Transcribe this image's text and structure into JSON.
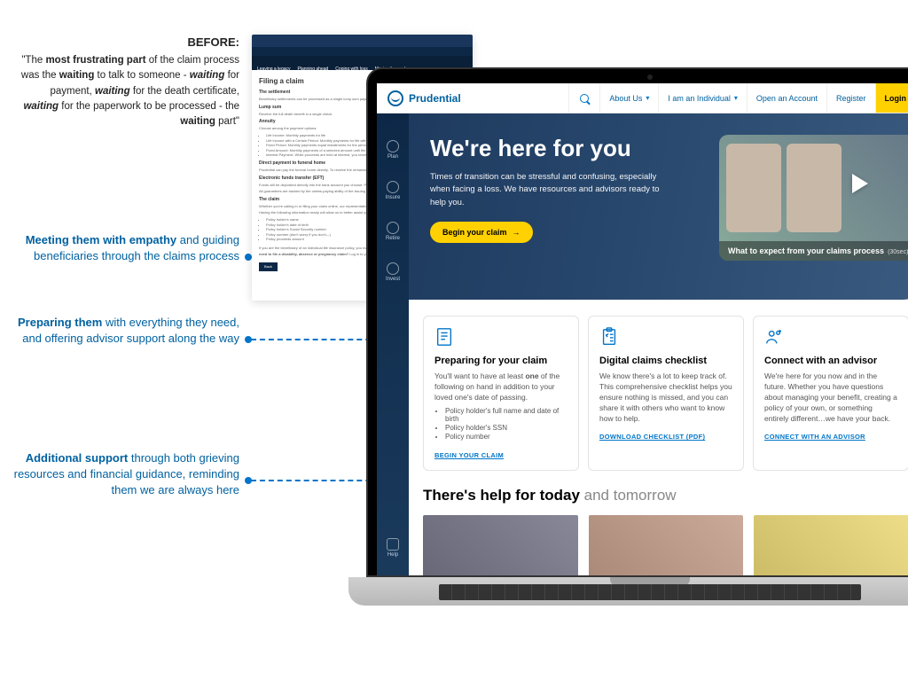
{
  "annotations": {
    "before_label": "BEFORE:",
    "quote_html": "\"The <b>most frustrating part</b> of the claim process was the <b>waiting</b> to talk to someone - <b><i>waiting</i></b> for payment, <b><i>waiting</i></b> for the death certificate, <b><i>waiting</i></b> for the paperwork to be processed - the <b>waiting</b> part\"",
    "callout1_html": "<b>Meeting them with empathy</b> and guiding beneficiaries through the claims process",
    "callout2_html": "<b>Preparing them</b> with everything they need, and offering advisor support along the way",
    "callout3_html": "<b>Additional support</b> through both grieving resources and financial guidance, reminding them we are always here"
  },
  "before": {
    "title": "Filing a claim",
    "nav": [
      "Leaving a legacy",
      "Planning ahead",
      "Coping with loss",
      "Moving forward"
    ],
    "sections": [
      "The settlement",
      "Lump sum",
      "Annuity",
      "Direct payment to funeral home",
      "Electronic funds transfer (EFT)",
      "The claim"
    ],
    "button": "Back"
  },
  "topnav": {
    "brand": "Prudential",
    "about": "About Us",
    "persona": "I am an Individual",
    "open": "Open an Account",
    "register": "Register",
    "login": "Login"
  },
  "sidebar": [
    "Plan",
    "Insure",
    "Retire",
    "Invest",
    "Help"
  ],
  "hero": {
    "title": "We're here for you",
    "body": "Times of transition can be stressful and confusing, especially when facing a loss. We have resources and advisors ready to help you.",
    "cta": "Begin your claim",
    "video_caption": "What to expect from your claims process",
    "video_time": "(30sec)"
  },
  "cards": [
    {
      "title": "Preparing for your claim",
      "body_html": "You'll want to have at least <b>one</b> of the following on hand in addition to your loved one's date of passing.",
      "bullets": [
        "Policy holder's full name and date of birth",
        "Policy holder's SSN",
        "Policy number"
      ],
      "link": "BEGIN YOUR CLAIM"
    },
    {
      "title": "Digital claims checklist",
      "body": "We know there's a lot to keep track of. This comprehensive checklist helps you ensure nothing is missed, and you can share it with others who want to know how to help.",
      "link": "DOWNLOAD CHECKLIST (PDF)"
    },
    {
      "title": "Connect with an advisor",
      "body": "We're here for you now and in the future. Whether you have questions about managing your benefit, creating a policy of your own, or something entirely different…we have your back.",
      "link": "CONNECT WITH AN ADVISOR"
    }
  ],
  "help": {
    "heading_bold": "There's help for today",
    "heading_light": " and tomorrow"
  }
}
